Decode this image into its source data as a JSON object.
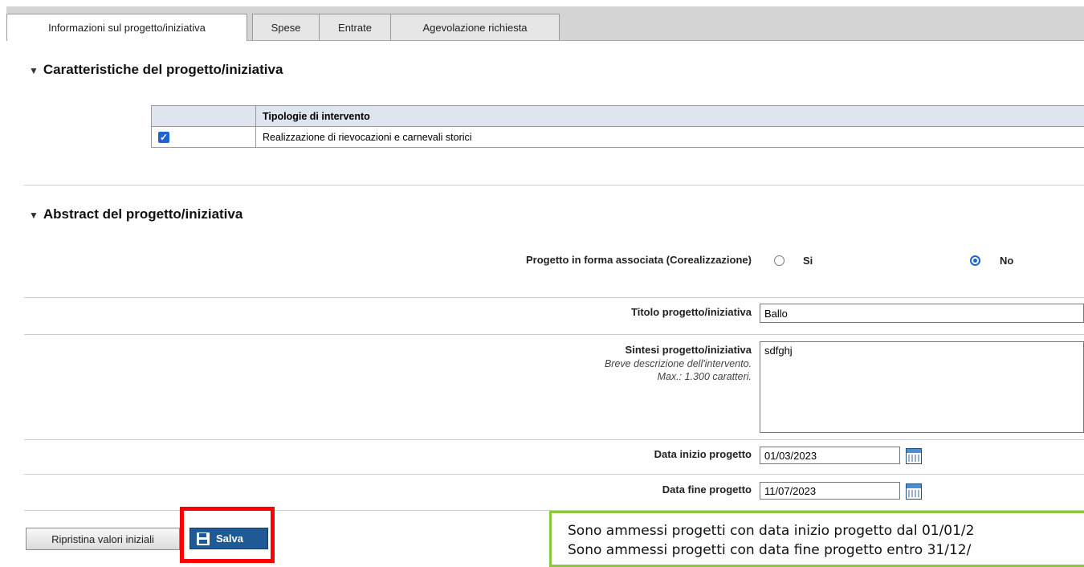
{
  "tabs": [
    {
      "label": "Informazioni sul progetto/iniziativa",
      "active": true
    },
    {
      "label": "Spese",
      "active": false
    },
    {
      "label": "Entrate",
      "active": false
    },
    {
      "label": "Agevolazione richiesta",
      "active": false
    }
  ],
  "section1": {
    "title": "Caratteristiche del progetto/iniziativa",
    "table": {
      "header": "Tipologie di intervento",
      "rows": [
        {
          "checked": true,
          "label": "Realizzazione di rievocazioni e carnevali storici"
        }
      ]
    }
  },
  "section2": {
    "title": "Abstract del progetto/iniziativa",
    "associata": {
      "label": "Progetto in forma associata (Corealizzazione)",
      "option_si": "Si",
      "option_no": "No",
      "selected": "No"
    },
    "titolo": {
      "label": "Titolo progetto/iniziativa",
      "value": "Ballo"
    },
    "sintesi": {
      "label": "Sintesi progetto/iniziativa",
      "help1": "Breve descrizione dell'intervento.",
      "help2": "Max.: 1.300 caratteri.",
      "value": "sdfghj"
    },
    "data_inizio": {
      "label": "Data inizio progetto",
      "value": "01/03/2023"
    },
    "data_fine": {
      "label": "Data fine progetto",
      "value": "11/07/2023"
    }
  },
  "buttons": {
    "reset": "Ripristina valori iniziali",
    "save": "Salva"
  },
  "note": {
    "line1": "Sono ammessi progetti con data inizio progetto dal 01/01/2",
    "line2": "Sono ammessi progetti con data fine progetto entro 31/12/"
  },
  "colors": {
    "accent": "#1e63d6",
    "highlight": "#ff0000",
    "note_border": "#8cc63f"
  }
}
